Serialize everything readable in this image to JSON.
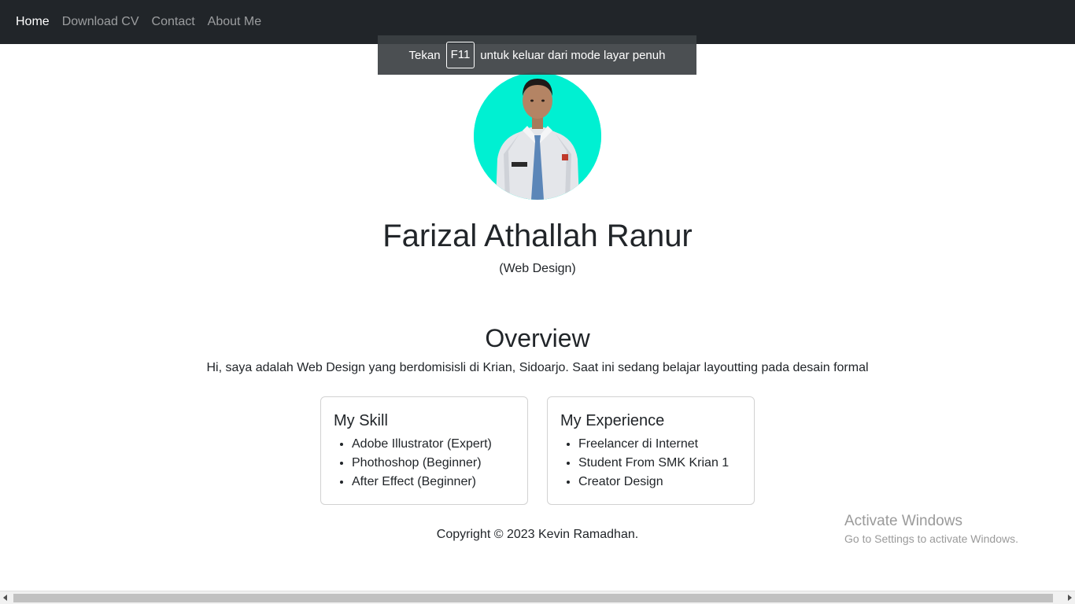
{
  "nav": {
    "items": [
      {
        "label": "Home",
        "active": true
      },
      {
        "label": "Download CV",
        "active": false
      },
      {
        "label": "Contact",
        "active": false
      },
      {
        "label": "About Me",
        "active": false
      }
    ]
  },
  "fullscreen_notice": {
    "prefix": "Tekan",
    "key": "F11",
    "suffix": "untuk keluar dari mode layar penuh"
  },
  "profile": {
    "name": "Farizal Athallah Ranur",
    "role": "(Web Design)",
    "avatar_bg": "#00f0d2"
  },
  "overview": {
    "title": "Overview",
    "text": "Hi, saya adalah Web Design yang berdomisisli di Krian, Sidoarjo. Saat ini sedang belajar layoutting pada desain formal"
  },
  "skills": {
    "title": "My Skill",
    "items": [
      "Adobe Illustrator (Expert)",
      "Phothoshop (Beginner)",
      "After Effect (Beginner)"
    ]
  },
  "experience": {
    "title": "My Experience",
    "items": [
      "Freelancer di Internet",
      "Student From SMK Krian 1",
      "Creator Design"
    ]
  },
  "footer": {
    "copyright": "Copyright © 2023 Kevin Ramadhan."
  },
  "os_watermark": {
    "line1": "Activate Windows",
    "line2": "Go to Settings to activate Windows."
  },
  "colors": {
    "navbar_bg": "#212529",
    "text": "#212529"
  }
}
